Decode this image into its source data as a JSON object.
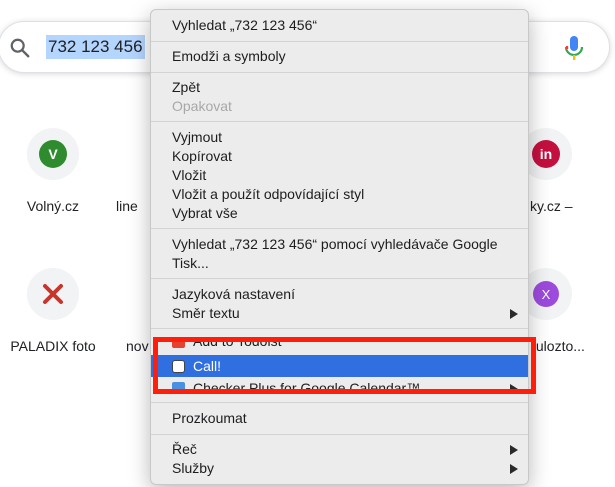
{
  "search": {
    "query": "732 123 456"
  },
  "tiles": [
    {
      "label": "Volný.cz",
      "letter": "V"
    },
    {
      "label": "line"
    },
    {
      "label": "ky.cz –",
      "letter": "in"
    },
    {
      "label": "PALADIX foto"
    },
    {
      "label": "nov"
    },
    {
      "label": "/ulozto...",
      "letter": "X"
    }
  ],
  "menu": {
    "search_query": "Vyhledat „732 123 456“",
    "emoji": "Emodži a symboly",
    "undo": "Zpět",
    "redo": "Opakovat",
    "cut": "Vyjmout",
    "copy": "Kopírovat",
    "paste": "Vložit",
    "paste_match": "Vložit a použít odpovídající styl",
    "select_all": "Vybrat vše",
    "search_google": "Vyhledat „732 123 456“ pomocí vyhledávače Google",
    "print": "Tisk...",
    "language": "Jazyková nastavení",
    "direction": "Směr textu",
    "ext_todoist": "Add to Todoist",
    "ext_call": "Call!",
    "ext_checker": "Checker Plus for Google Calendar™",
    "inspect": "Prozkoumat",
    "speech": "Řeč",
    "services": "Služby"
  },
  "colors": {
    "highlight": "#2f6fdf",
    "annotation_box": "#ff1e0a"
  }
}
